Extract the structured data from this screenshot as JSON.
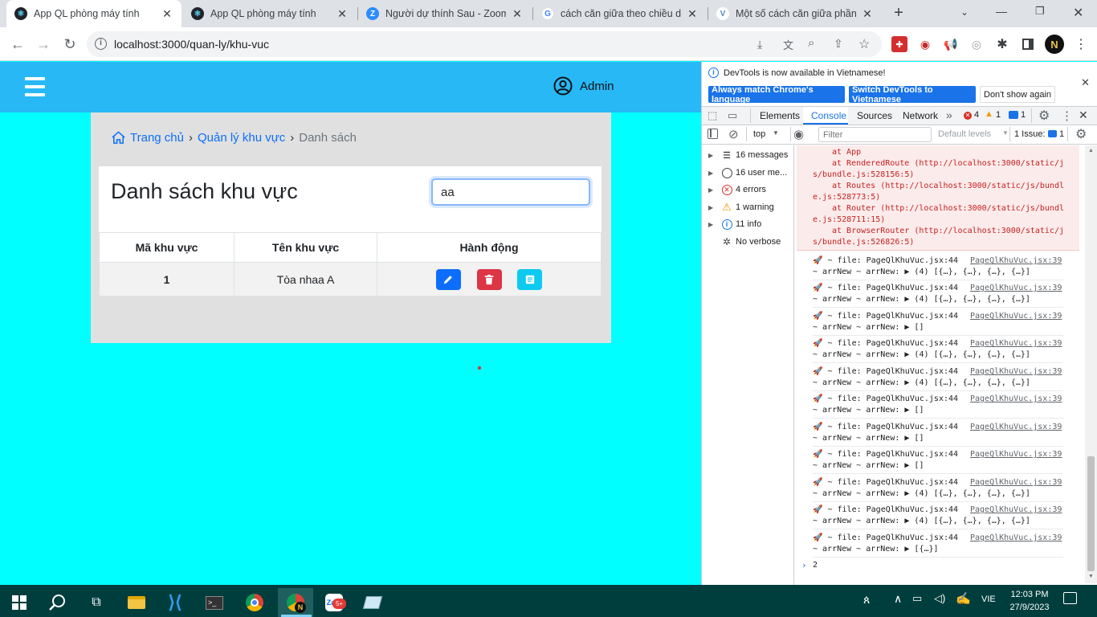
{
  "browser": {
    "tabs": [
      {
        "label": "App QL phòng máy tính",
        "active": true,
        "favicon": "react-icon"
      },
      {
        "label": "App QL phòng máy tính",
        "active": false,
        "favicon": "react-icon"
      },
      {
        "label": "Người dự thính Sau - Zoom",
        "active": false,
        "favicon": "zoom-icon"
      },
      {
        "label": "cách căn giữa theo chiều dọ",
        "active": false,
        "favicon": "google-icon"
      },
      {
        "label": "Một số cách căn giữa phần",
        "active": false,
        "favicon": "viblo-icon"
      }
    ],
    "url": "localhost:3000/quan-ly/khu-vuc"
  },
  "app": {
    "user_label": "Admin",
    "breadcrumb": {
      "home": "Trang chủ",
      "section": "Quản lý khu vực",
      "current": "Danh sách"
    },
    "page_title": "Danh sách khu vực",
    "search_value": "aa",
    "table": {
      "headers": [
        "Mã khu vực",
        "Tên khu vực",
        "Hành động"
      ],
      "rows": [
        {
          "id": "1",
          "name": "Tòa nhaa A"
        }
      ]
    }
  },
  "devtools": {
    "notice": "DevTools is now available in Vietnamese!",
    "btn_match": "Always match Chrome's language",
    "btn_switch": "Switch DevTools to Vietnamese",
    "btn_dont_show": "Don't show again",
    "tabs": [
      "Elements",
      "Console",
      "Sources",
      "Network"
    ],
    "active_tab": "Console",
    "error_count": "4",
    "warning_count": "1",
    "info_count": "1",
    "context": "top",
    "filter_placeholder": "Filter",
    "levels": "Default levels",
    "issues": "1 Issue:",
    "issues_count": "1",
    "sidebar": [
      {
        "label": "16 messages",
        "icon": "list-icon"
      },
      {
        "label": "16 user me...",
        "icon": "user-icon"
      },
      {
        "label": "4 errors",
        "icon": "error-icon"
      },
      {
        "label": "1 warning",
        "icon": "warning-icon"
      },
      {
        "label": "11 info",
        "icon": "info-icon"
      },
      {
        "label": "No verbose",
        "icon": "bug-icon"
      }
    ],
    "stack": [
      {
        "text": "at App",
        "link": ""
      },
      {
        "text": "at RenderedRoute (",
        "link": "http://localhost:3000/static/js/bundle.js:528156:5",
        "tail": ")"
      },
      {
        "text": "at Routes (",
        "link": "http://localhost:3000/static/js/bundle.js:528773:5",
        "tail": ")"
      },
      {
        "text": "at Router (",
        "link": "http://localhost:3000/static/js/bundle.js:528711:15",
        "tail": ")"
      },
      {
        "text": "at BrowserRouter (",
        "link": "http://localhost:3000/static/js/bundle.js:526826:5",
        "tail": ")"
      }
    ],
    "stack_display": [
      "at App",
      "at RenderedRoute (http://localhost:3000/static/j",
      "s/bundle.js:528156:5)",
      "at Routes (http://localhost:3000/static/js/bundl",
      "e.js:528773:5)",
      "at Router (http://localhost:3000/static/js/bundl",
      "e.js:528711:15)",
      "at BrowserRouter (http://localhost:3000/static/j",
      "s/bundle.js:526826:5)"
    ],
    "logs": [
      {
        "line1": "🚀 ~ file: PageQlKhuVuc.jsx:44",
        "line2": "~ arrNew ~ arrNew:  ▶ (4) [{…}, {…}, {…}, {…}]",
        "source": "PageQlKhuVuc.jsx:39"
      },
      {
        "line1": "🚀 ~ file: PageQlKhuVuc.jsx:44",
        "line2": "~ arrNew ~ arrNew:  ▶ (4) [{…}, {…}, {…}, {…}]",
        "source": "PageQlKhuVuc.jsx:39"
      },
      {
        "line1": "🚀 ~ file: PageQlKhuVuc.jsx:44",
        "line2": "~ arrNew ~ arrNew:  ▶ []",
        "source": "PageQlKhuVuc.jsx:39"
      },
      {
        "line1": "🚀 ~ file: PageQlKhuVuc.jsx:44",
        "line2": "~ arrNew ~ arrNew:  ▶ (4) [{…}, {…}, {…}, {…}]",
        "source": "PageQlKhuVuc.jsx:39"
      },
      {
        "line1": "🚀 ~ file: PageQlKhuVuc.jsx:44",
        "line2": "~ arrNew ~ arrNew:  ▶ (4) [{…}, {…}, {…}, {…}]",
        "source": "PageQlKhuVuc.jsx:39"
      },
      {
        "line1": "🚀 ~ file: PageQlKhuVuc.jsx:44",
        "line2": "~ arrNew ~ arrNew:  ▶ []",
        "source": "PageQlKhuVuc.jsx:39"
      },
      {
        "line1": "🚀 ~ file: PageQlKhuVuc.jsx:44",
        "line2": "~ arrNew ~ arrNew:  ▶ []",
        "source": "PageQlKhuVuc.jsx:39"
      },
      {
        "line1": "🚀 ~ file: PageQlKhuVuc.jsx:44",
        "line2": "~ arrNew ~ arrNew:  ▶ []",
        "source": "PageQlKhuVuc.jsx:39"
      },
      {
        "line1": "🚀 ~ file: PageQlKhuVuc.jsx:44",
        "line2": "~ arrNew ~ arrNew:  ▶ (4) [{…}, {…}, {…}, {…}]",
        "source": "PageQlKhuVuc.jsx:39"
      },
      {
        "line1": "🚀 ~ file: PageQlKhuVuc.jsx:44",
        "line2": "~ arrNew ~ arrNew:  ▶ (4) [{…}, {…}, {…}, {…}]",
        "source": "PageQlKhuVuc.jsx:39"
      },
      {
        "line1": "🚀 ~ file: PageQlKhuVuc.jsx:44",
        "line2": "~ arrNew ~ arrNew:  ▶ [{…}]",
        "source": "PageQlKhuVuc.jsx:39"
      }
    ],
    "prompt_value": "2"
  },
  "taskbar": {
    "time": "12:03 PM",
    "date": "27/9/2023",
    "language": "VIE",
    "zalo_badge": "5+"
  },
  "colors": {
    "page_bg": "#00ffff",
    "header_bg": "#28b8f6",
    "card_bg": "#e0e0e0",
    "edit_btn": "#0d6efd",
    "delete_btn": "#dc3545",
    "detail_btn": "#0dcaf0",
    "link": "#0d6efd",
    "console_error_bg": "#fcebeb",
    "taskbar_bg": "#003e3e"
  }
}
